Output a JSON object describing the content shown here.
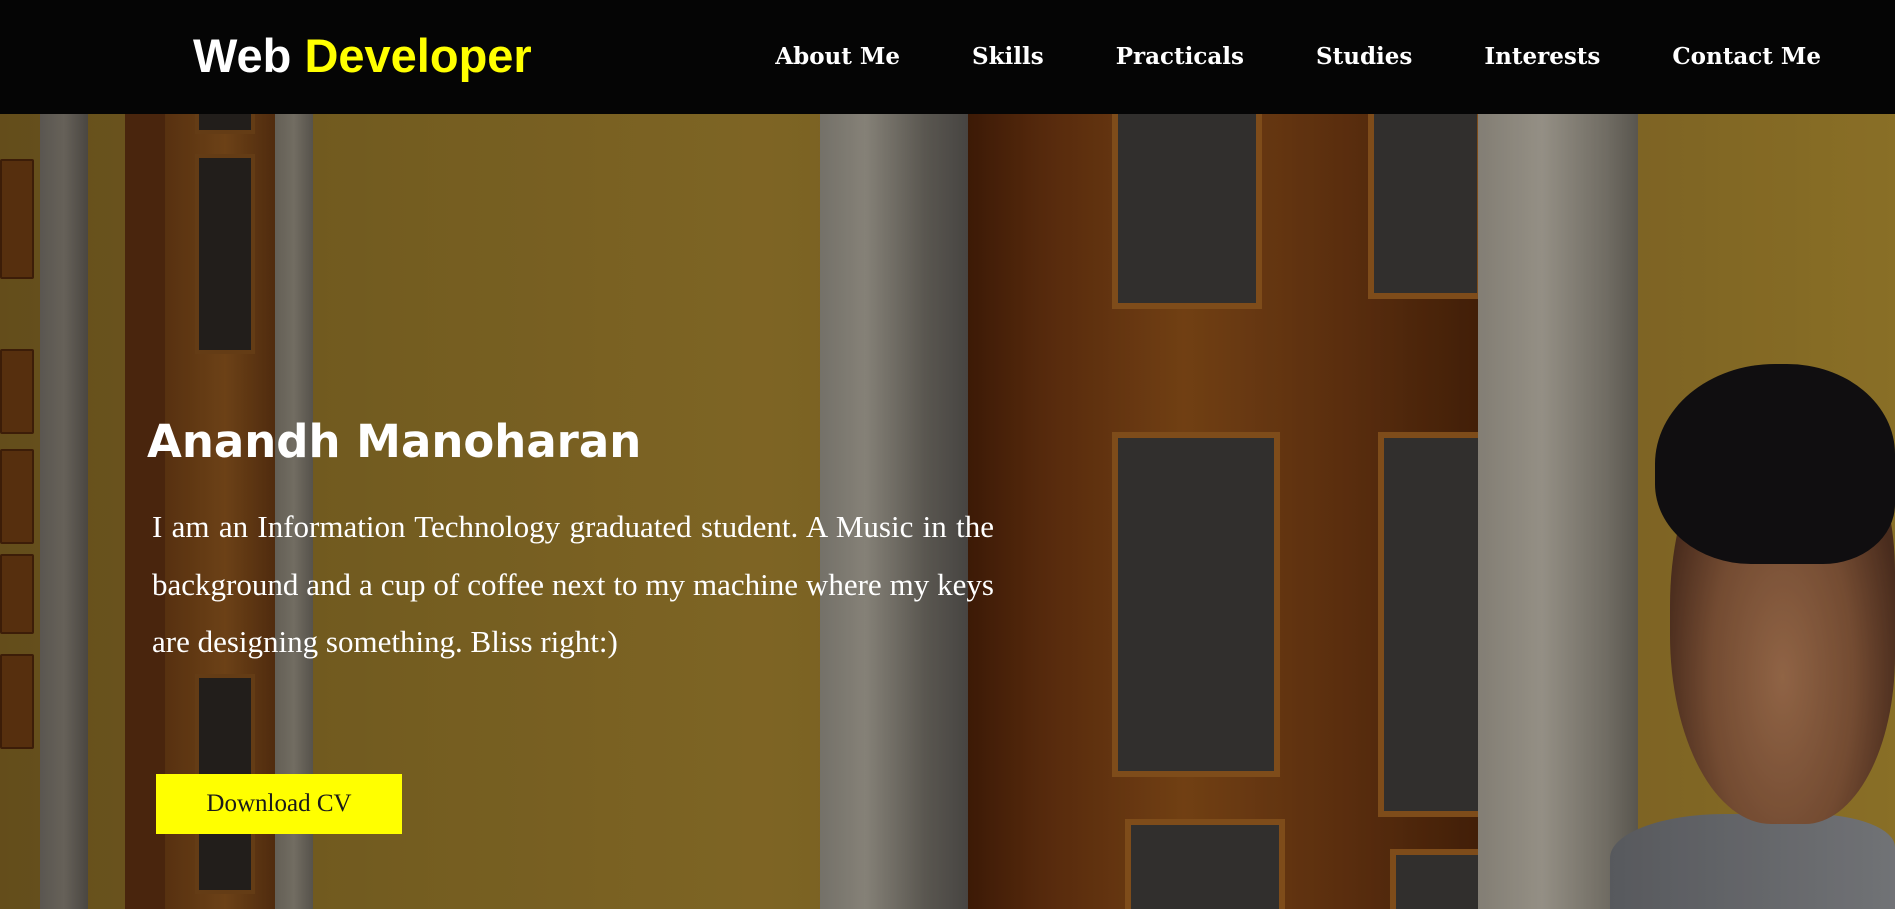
{
  "header": {
    "brand_first": "Web",
    "brand_second": "Developer",
    "nav": [
      {
        "label": "About Me"
      },
      {
        "label": "Skills"
      },
      {
        "label": "Practicals"
      },
      {
        "label": "Studies"
      },
      {
        "label": "Interests"
      },
      {
        "label": "Contact Me"
      }
    ]
  },
  "hero": {
    "name": "Anandh Manoharan",
    "bio": "I am an Information Technology graduated student. A Music in the background and a cup of coffee next to my machine where my keys are designing something. Bliss right:)",
    "cv_button": "Download CV"
  },
  "colors": {
    "navbar_bg": "#050505",
    "accent": "#ffff00",
    "text": "#ffffff",
    "button_text": "#1a1a1a"
  }
}
